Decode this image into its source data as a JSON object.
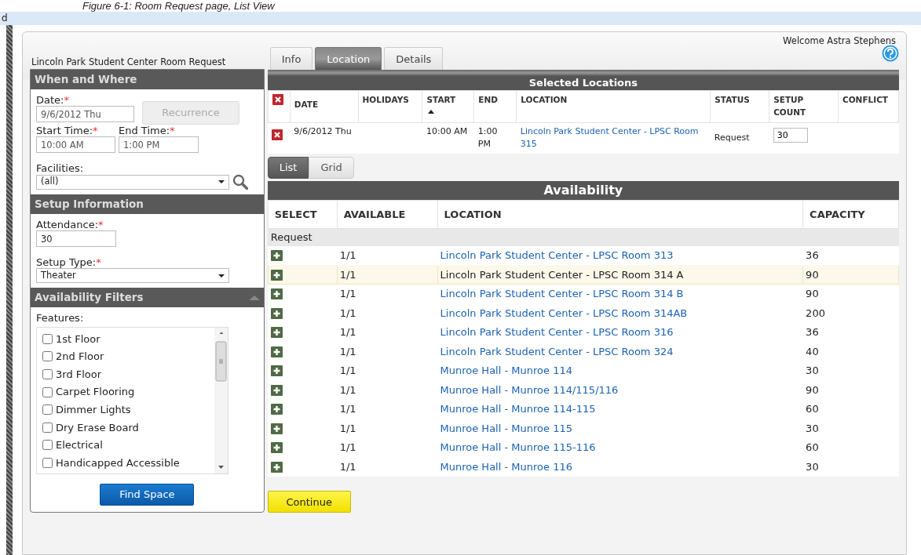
{
  "caption": "Figure 6-1: Room Request page, List View",
  "browser_bar": {
    "text": "d"
  },
  "welcome": "Welcome Astra Stephens",
  "page_title": "Lincoln Park Student Center Room Request",
  "tabs": [
    {
      "label": "Info",
      "selected": false
    },
    {
      "label": "Location",
      "selected": true
    },
    {
      "label": "Details",
      "selected": false
    }
  ],
  "sidebar": {
    "when_and_where": {
      "title": "When and Where",
      "date": {
        "label": "Date:",
        "required_mark": "*",
        "value": "9/6/2012 Thu"
      },
      "recurrence_button": {
        "label": "Recurrence",
        "disabled": true
      },
      "start_time": {
        "label": "Start Time:",
        "required_mark": "*",
        "value": "10:00 AM"
      },
      "end_time": {
        "label": "End Time:",
        "required_mark": "*",
        "value": "1:00 PM"
      },
      "facilities": {
        "label": "Facilities:",
        "value": "(all)"
      }
    },
    "setup_information": {
      "title": "Setup Information",
      "attendance": {
        "label": "Attendance:",
        "required_mark": "*",
        "value": "30"
      },
      "setup_type": {
        "label": "Setup Type:",
        "required_mark": "*",
        "value": "Theater"
      }
    },
    "availability_filters": {
      "title": "Availability Filters",
      "expanded": true,
      "features_label": "Features:",
      "features": [
        {
          "label": "1st Floor",
          "checked": false
        },
        {
          "label": "2nd Floor",
          "checked": false
        },
        {
          "label": "3rd Floor",
          "checked": false
        },
        {
          "label": "Carpet Flooring",
          "checked": false
        },
        {
          "label": "Dimmer Lights",
          "checked": false
        },
        {
          "label": "Dry Erase Board",
          "checked": false
        },
        {
          "label": "Electrical",
          "checked": false
        },
        {
          "label": "Handicapped Accessible",
          "checked": false
        }
      ]
    },
    "find_button": "Find Space"
  },
  "selected_locations": {
    "title": "Selected Locations",
    "columns": [
      {
        "label": "DATE"
      },
      {
        "label": "HOLIDAYS"
      },
      {
        "label": "START",
        "sorted": true
      },
      {
        "label": "END"
      },
      {
        "label": "LOCATION"
      },
      {
        "label": "STATUS"
      },
      {
        "label": "SETUP COUNT"
      },
      {
        "label": "CONFLICT"
      }
    ],
    "rows": [
      {
        "date": "9/6/2012 Thu",
        "start": "10:00 AM",
        "end": "1:00 PM",
        "location": "Lincoln Park Student Center - LPSC Room 315",
        "status": "Request",
        "setup_count": "30"
      }
    ]
  },
  "view_toggle": [
    {
      "label": "List",
      "selected": true
    },
    {
      "label": "Grid",
      "selected": false
    }
  ],
  "availability": {
    "title": "Availability",
    "columns": [
      "SELECT",
      "AVAILABLE",
      "LOCATION",
      "CAPACITY"
    ],
    "group": "Request",
    "rows": [
      {
        "available": "1/1",
        "location": "Lincoln Park Student Center - LPSC Room 313",
        "capacity": "36",
        "highlighted": false
      },
      {
        "available": "1/1",
        "location": "Lincoln Park Student Center - LPSC Room 314 A",
        "capacity": "90",
        "highlighted": true
      },
      {
        "available": "1/1",
        "location": "Lincoln Park Student Center - LPSC Room 314 B",
        "capacity": "90",
        "highlighted": false
      },
      {
        "available": "1/1",
        "location": "Lincoln Park Student Center - LPSC Room 314AB",
        "capacity": "200",
        "highlighted": false
      },
      {
        "available": "1/1",
        "location": "Lincoln Park Student Center - LPSC Room 316",
        "capacity": "36",
        "highlighted": false
      },
      {
        "available": "1/1",
        "location": "Lincoln Park Student Center - LPSC Room 324",
        "capacity": "40",
        "highlighted": false
      },
      {
        "available": "1/1",
        "location": "Munroe Hall - Munroe 114",
        "capacity": "30",
        "highlighted": false
      },
      {
        "available": "1/1",
        "location": "Munroe Hall - Munroe 114/115/116",
        "capacity": "90",
        "highlighted": false
      },
      {
        "available": "1/1",
        "location": "Munroe Hall - Munroe 114-115",
        "capacity": "60",
        "highlighted": false
      },
      {
        "available": "1/1",
        "location": "Munroe Hall - Munroe 115",
        "capacity": "30",
        "highlighted": false
      },
      {
        "available": "1/1",
        "location": "Munroe Hall - Munroe 115-116",
        "capacity": "60",
        "highlighted": false
      },
      {
        "available": "1/1",
        "location": "Munroe Hall - Munroe 116",
        "capacity": "30",
        "highlighted": false
      }
    ]
  },
  "continue_button": "Continue"
}
